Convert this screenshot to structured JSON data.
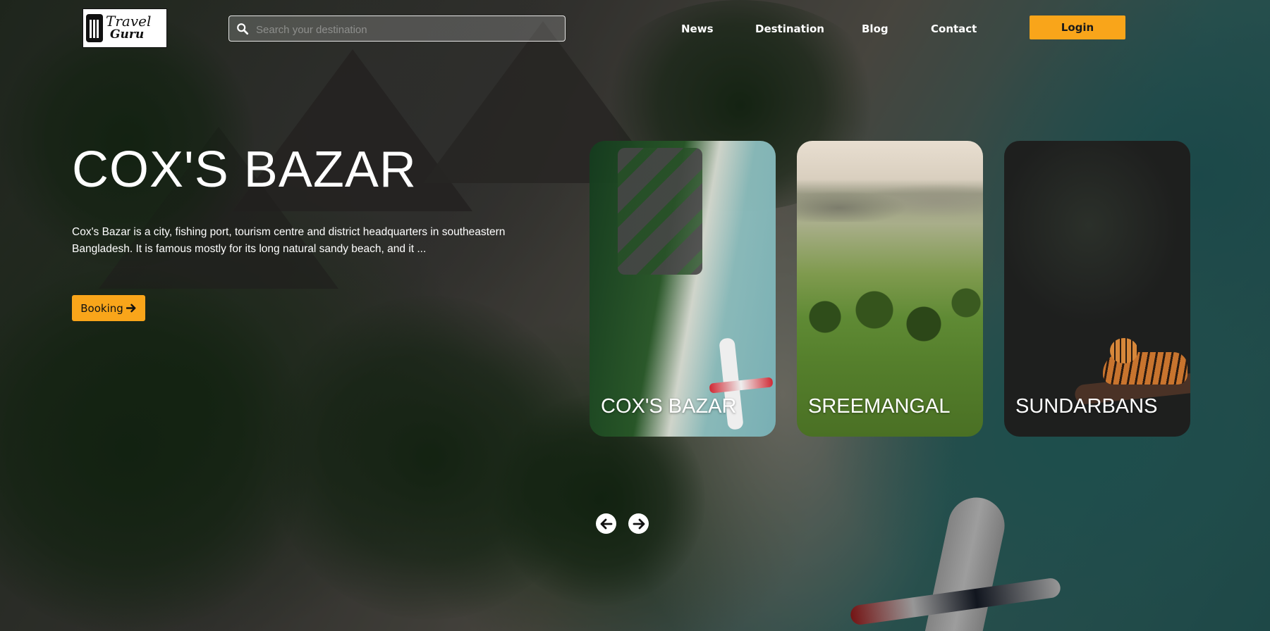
{
  "brand": {
    "logo_line1": "Travel",
    "logo_line2": "Guru"
  },
  "search": {
    "placeholder": "Search your destination",
    "value": ""
  },
  "nav": {
    "items": [
      {
        "label": "News"
      },
      {
        "label": "Destination"
      },
      {
        "label": "Blog"
      },
      {
        "label": "Contact"
      }
    ],
    "login_label": "Login"
  },
  "hero": {
    "title": "COX'S BAZAR",
    "description": "Cox's Bazar is a city, fishing port, tourism centre and district headquarters in southeastern Bangladesh. It is famous mostly for its long natural sandy beach, and it ...",
    "booking_label": "Booking"
  },
  "destinations": [
    {
      "name": "COX'S BAZAR"
    },
    {
      "name": "SREEMANGAL"
    },
    {
      "name": "SUNDARBANS"
    }
  ],
  "colors": {
    "accent": "#f9a51a",
    "text": "#ffffff"
  },
  "icons": {
    "search": "search-icon",
    "booking_arrow": "arrow-right-icon",
    "prev": "arrow-left-circle-icon",
    "next": "arrow-right-circle-icon"
  }
}
